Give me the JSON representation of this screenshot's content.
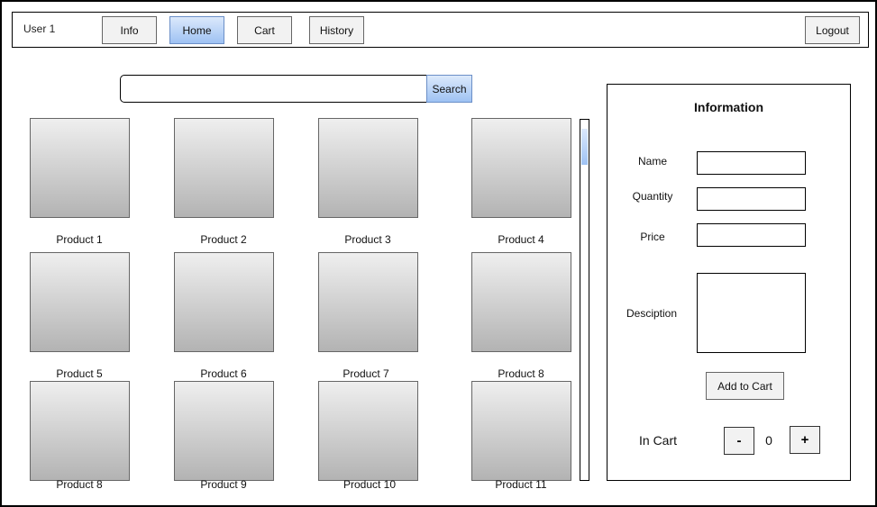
{
  "header": {
    "user": "User 1",
    "nav": [
      {
        "label": "Info"
      },
      {
        "label": "Home"
      },
      {
        "label": "Cart"
      },
      {
        "label": "History"
      }
    ],
    "logout": "Logout"
  },
  "search": {
    "button": "Search",
    "value": ""
  },
  "products": [
    "Product 1",
    "Product 2",
    "Product 3",
    "Product 4",
    "Product 5",
    "Product 6",
    "Product 7",
    "Product 8",
    "Product 8",
    "Product 9",
    "Product 10",
    "Product 11"
  ],
  "info_panel": {
    "title": "Information",
    "labels": {
      "name": "Name",
      "quantity": "Quantity",
      "price": "Price",
      "description": "Desciption"
    },
    "add_to_cart": "Add to Cart",
    "in_cart_label": "In Cart",
    "decrement": "-",
    "increment": "+",
    "count": "0"
  },
  "colors": {
    "accent_top": "#dce9fb",
    "accent_bottom": "#9ec2f3"
  }
}
